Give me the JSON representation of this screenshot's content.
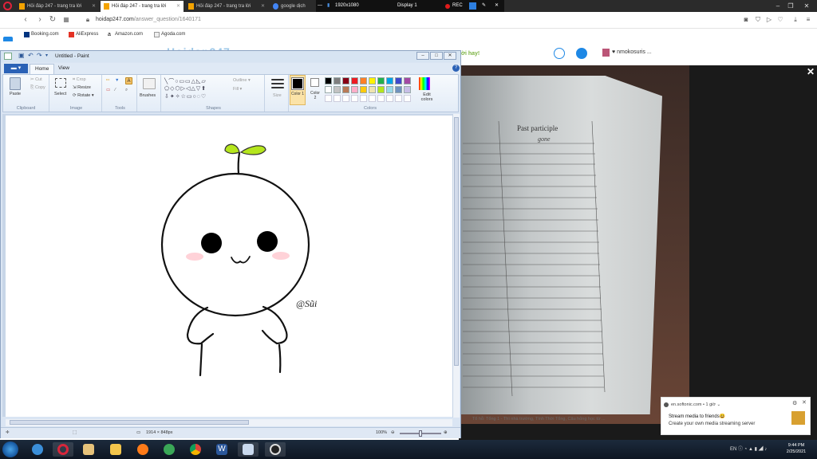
{
  "browser": {
    "tabs": [
      {
        "label": "Hỏi đáp 247 - trang tra lời",
        "icon": "hoidap-favicon"
      },
      {
        "label": "Hỏi đáp 247 - trang tra lời",
        "icon": "hoidap-favicon"
      },
      {
        "label": "Hỏi đáp 247 - trang tra lời",
        "icon": "hoidap-favicon"
      },
      {
        "label": "google dịch",
        "icon": "google-favicon"
      }
    ],
    "recorder": {
      "resolution": "1920x1080",
      "display": "Display 1",
      "rec_label": "REC"
    },
    "url_host": "hoidap247.com",
    "url_path": "/answer_question/1640171",
    "bookmarks": [
      "Booking.com",
      "AliExpress",
      "Amazon.com",
      "Agoda.com"
    ]
  },
  "site": {
    "logo": "Hoidap247",
    "greeting": "ời hay!",
    "username": "♥ nmokosuris ..."
  },
  "paint": {
    "title": "Untitled - Paint",
    "tabs": {
      "home": "Home",
      "view": "View"
    },
    "clipboard": {
      "paste": "Paste",
      "cut": "Cut",
      "copy": "Copy",
      "group": "Clipboard"
    },
    "image": {
      "select": "Select",
      "crop": "Crop",
      "resize": "Resize",
      "rotate": "Rotate ▾",
      "group": "Image"
    },
    "tools_group": "Tools",
    "brushes": "Brushes",
    "shapes": {
      "outline": "Outline ▾",
      "fill": "Fill ▾",
      "group": "Shapes"
    },
    "size": "Size",
    "color1": "Color 1",
    "color2": "Color 2",
    "edit_colors": "Edit colors",
    "colors_group": "Colors",
    "palette": [
      "#000000",
      "#7f7f7f",
      "#880015",
      "#ed1c24",
      "#ff7f27",
      "#fff200",
      "#22b14c",
      "#00a2e8",
      "#3f48cc",
      "#a349a4",
      "#ffffff",
      "#c3c3c3",
      "#b97a57",
      "#ffaec9",
      "#ffc90e",
      "#efe4b0",
      "#b5e61d",
      "#99d9ea",
      "#7092be",
      "#c8bfe7"
    ],
    "drawing": {
      "signature": "@Sũi"
    },
    "status": {
      "canvas_size": "1914 × 848px",
      "zoom": "100%"
    }
  },
  "video": {
    "paper_header": "Past participle",
    "paper_word": "gone",
    "caption": "Tổ hỗ: Tổng 1 - Thì nhà trường, Tính Thời Tổng, Câu hỏng học từ ...",
    "close": "✕"
  },
  "notification": {
    "source": "en.softonic.com • 1 giờ ⌄",
    "title": "Stream media to friends😃",
    "body": "Create your own media streaming server"
  },
  "taskbar": {
    "tray_lang": "EN",
    "time": "9:44 PM",
    "date": "2/25/2021"
  }
}
